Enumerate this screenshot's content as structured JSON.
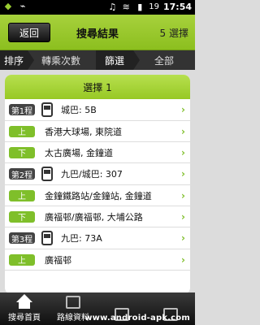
{
  "status": {
    "battery": "19",
    "time": "17:54"
  },
  "header": {
    "back_label": "返回",
    "title": "搜尋結果",
    "selection_count": "5 選擇"
  },
  "sort": {
    "sort_label": "排序",
    "sort_value": "轉乘次數",
    "filter_label": "篩選",
    "filter_value": "全部"
  },
  "results": {
    "option_title": "選擇 1",
    "rows": [
      {
        "type": "route",
        "tag": "第1程",
        "text": "城巴: 5B"
      },
      {
        "type": "stop",
        "tag": "上",
        "text": "香港大球場, 東院道"
      },
      {
        "type": "stop",
        "tag": "下",
        "text": "太古廣場, 金鐘道"
      },
      {
        "type": "route",
        "tag": "第2程",
        "text": "九巴/城巴: 307"
      },
      {
        "type": "stop",
        "tag": "上",
        "text": "金鐘鐵路站/金鐘站, 金鐘道"
      },
      {
        "type": "stop",
        "tag": "下",
        "text": "廣福邨/廣福邨, 大埔公路"
      },
      {
        "type": "route",
        "tag": "第3程",
        "text": "九巴: 73A"
      },
      {
        "type": "stop",
        "tag": "上",
        "text": "廣福邨"
      }
    ]
  },
  "bottom_nav": {
    "home": "搜尋首頁",
    "route": "路線資料",
    "watermark": "www.android-apk.com"
  },
  "colors": {
    "accent": "#8cbf1f",
    "dark": "#333333"
  }
}
